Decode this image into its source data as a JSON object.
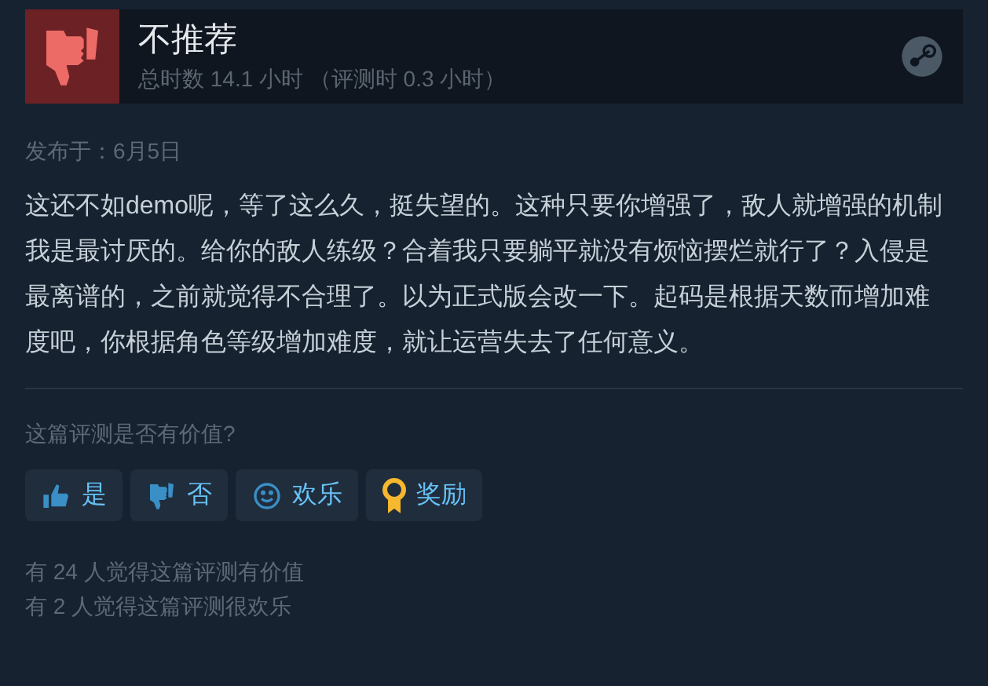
{
  "review": {
    "verdict": "不推荐",
    "hours": "总时数 14.1 小时 （评测时 0.3 小时）",
    "posted": "发布于：6月5日",
    "body": "这还不如demo呢，等了这么久，挺失望的。这种只要你增强了，敌人就增强的机制我是最讨厌的。给你的敌人练级？合着我只要躺平就没有烦恼摆烂就行了？入侵是最离谱的，之前就觉得不合理了。以为正式版会改一下。起码是根据天数而增加难度吧，你根据角色等级增加难度，就让运营失去了任何意义。"
  },
  "feedback": {
    "question": "这篇评测是否有价值?",
    "buttons": [
      {
        "kind": "up",
        "label": "是"
      },
      {
        "kind": "down",
        "label": "否"
      },
      {
        "kind": "smile",
        "label": "欢乐"
      },
      {
        "kind": "award",
        "label": "奖励"
      }
    ],
    "stats": [
      "有 24 人觉得这篇评测有价值",
      "有 2 人觉得这篇评测很欢乐"
    ]
  }
}
